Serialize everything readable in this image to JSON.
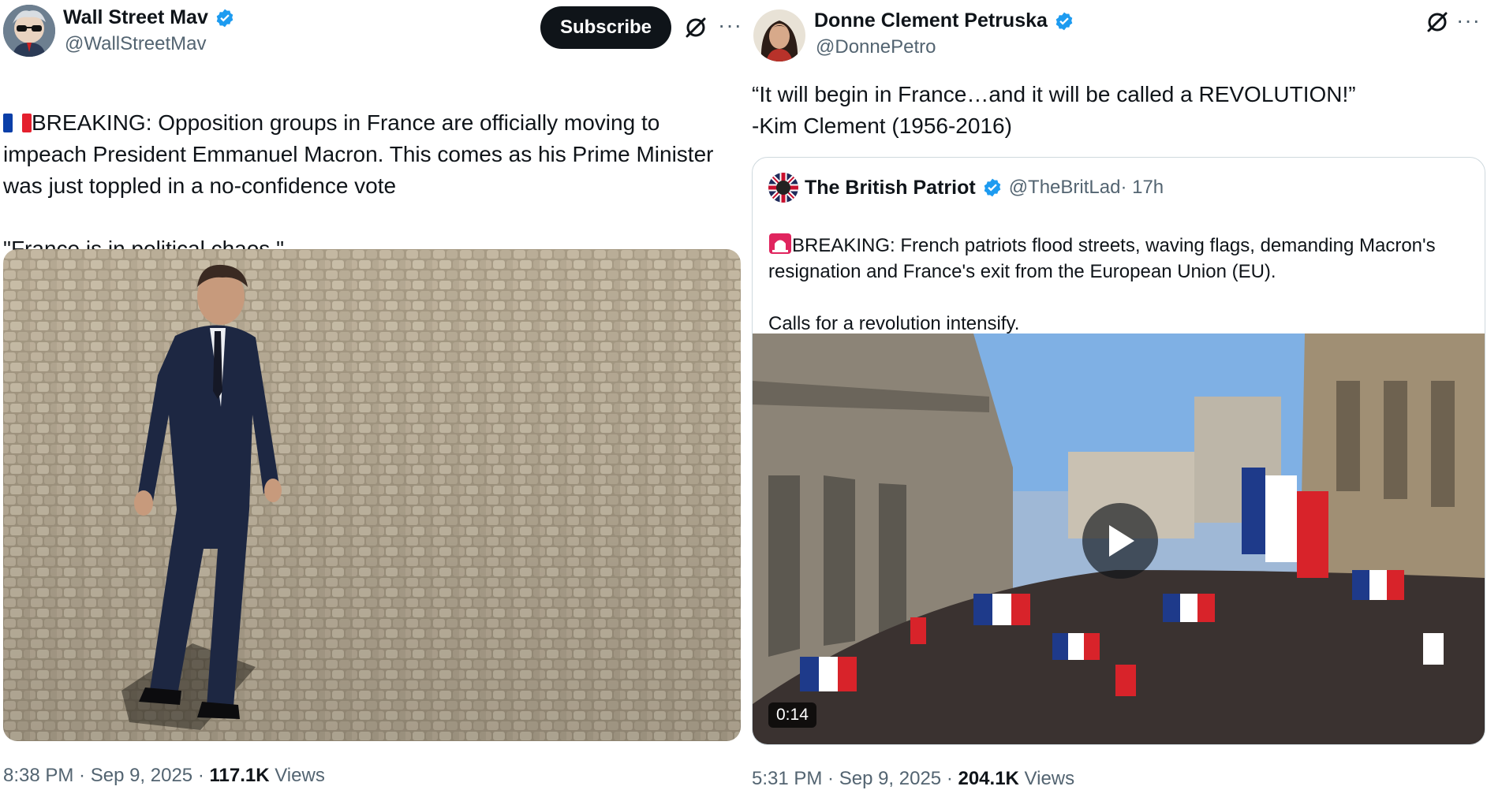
{
  "left_tweet": {
    "author": {
      "name": "Wall Street Mav",
      "handle": "@WallStreetMav",
      "avatar_icon": "avatar-sunglasses-icon"
    },
    "subscribe_label": "Subscribe",
    "text": "BREAKING: Opposition groups in France are officially moving to impeach President Emmanuel Macron. This comes as his Prime Minister was just toppled in a no-confidence vote\n\n\"France is in political chaos.\"",
    "flag_icon": "france-flag-icon",
    "time": "8:38 PM · Sep 9, 2025 · ",
    "views_count": "117.1K",
    "views_label": " Views"
  },
  "right_tweet": {
    "author": {
      "name": "Donne Clement Petruska",
      "handle": "@DonnePetro"
    },
    "text": "“It will begin in France…and it will be called a REVOLUTION!”\n-Kim Clement (1956-2016)",
    "quote": {
      "author_name": "The British Patriot",
      "author_handle": "@TheBritLad",
      "age": " · 17h",
      "siren_icon": "siren-icon",
      "text": "BREAKING: French patriots flood streets, waving flags, demanding Macron's resignation and France's exit from the European Union (EU).\n\nCalls for a revolution intensify.",
      "video_duration": "0:14"
    },
    "time": "5:31 PM · Sep 9, 2025 · ",
    "views_count": "204.1K",
    "views_label": " Views"
  },
  "colors": {
    "verified_blue": "#1d9bf0",
    "text_secondary": "#536471",
    "text_primary": "#0f1419"
  }
}
